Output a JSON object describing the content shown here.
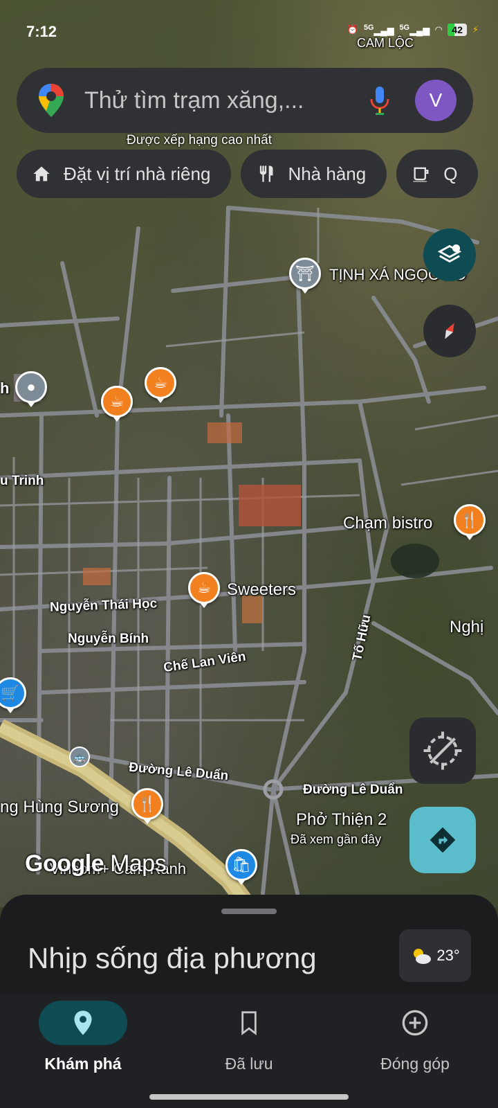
{
  "status_bar": {
    "time": "7:12",
    "network_1": "5G",
    "network_2": "5G",
    "battery": "42"
  },
  "search": {
    "placeholder": "Thử tìm trạm xăng,...",
    "avatar_letter": "V"
  },
  "banner": {
    "top_rated": "Được xếp hạng cao nhất"
  },
  "chips": [
    {
      "label": "Đặt vị trí nhà riêng",
      "icon": "home-icon"
    },
    {
      "label": "Nhà hàng",
      "icon": "restaurant-icon"
    },
    {
      "label": "Q",
      "icon": "coffee-icon"
    }
  ],
  "map": {
    "area_label": "CAM LỘC",
    "labels": {
      "tinh_xa": "TỊNH XÁ NGỌC HÒ",
      "trinh": "u Trinh",
      "cham_bistro": "Chạm bistro",
      "sweeters": "Sweeters",
      "nguyen_thai_hoc": "Nguyễn Thái Học",
      "nguyen_binh": "Nguyễn Bính",
      "che_lan_vien": "Chế Lan Viên",
      "to_huu": "Tố Hữu",
      "nghi": "Nghị",
      "le_duan_1": "Đường Lê Duẩn",
      "le_duan_2": "Đường Lê Duẩn",
      "hung_suong": "ng Hùng Sương",
      "pho_thien": "Phở Thiện 2",
      "pho_thien_sub": "Đã xem gần đây",
      "vincom": "Vincom+ Cam Ranh",
      "h_left": "h"
    },
    "logo": {
      "google": "Google",
      "maps": "Maps"
    }
  },
  "sheet": {
    "title": "Nhịp sống địa phương",
    "temperature": "23°"
  },
  "nav": {
    "explore": "Khám phá",
    "saved": "Đã lưu",
    "contribute": "Đóng góp"
  },
  "colors": {
    "accent": "#0e4b52",
    "poi_orange": "#f2801e",
    "directions": "#5bbccc"
  }
}
